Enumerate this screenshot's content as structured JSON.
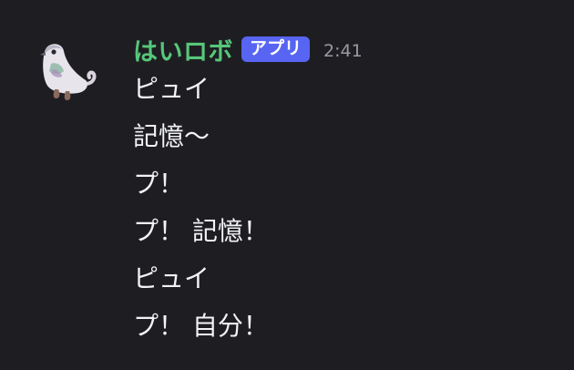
{
  "message": {
    "avatar_icon": "pigeon-robot-avatar-icon",
    "username": "はいロボ",
    "username_color": "#57c77a",
    "badge": "アプリ",
    "badge_color": "#5865f2",
    "timestamp": "2:41",
    "lines": [
      "ピュイ",
      "記憶〜",
      "プ！",
      "プ！ 記憶！",
      "ピュイ",
      "プ！ 自分！"
    ]
  }
}
